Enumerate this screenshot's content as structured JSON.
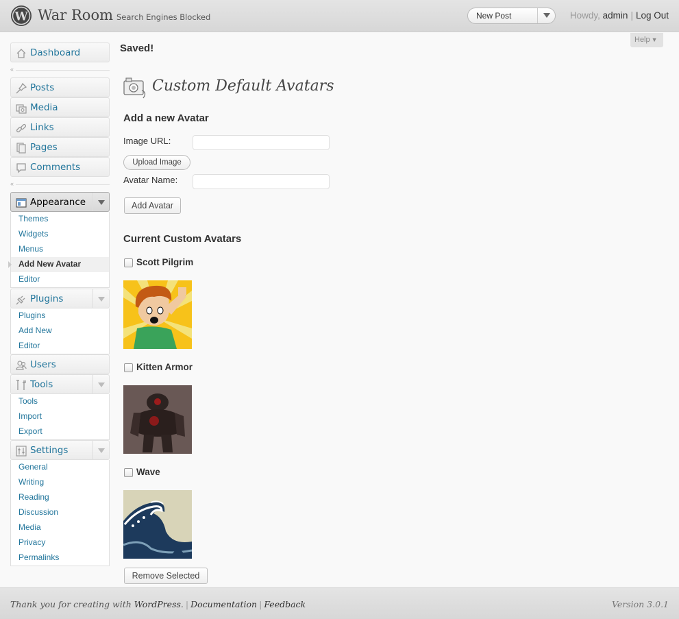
{
  "header": {
    "site_title": "War Room",
    "site_subtitle": "Search Engines Blocked",
    "favorite_action": "New Post",
    "howdy": "Howdy, ",
    "user": "admin",
    "separator": "|",
    "logout": "Log Out"
  },
  "help": {
    "label": "Help",
    "arrow": "▼"
  },
  "sidebar": {
    "collapse_glyph": "«",
    "dashboard": "Dashboard",
    "posts": "Posts",
    "media": "Media",
    "links": "Links",
    "pages": "Pages",
    "comments": "Comments",
    "appearance": {
      "label": "Appearance",
      "items": [
        "Themes",
        "Widgets",
        "Menus",
        "Add New Avatar",
        "Editor"
      ]
    },
    "plugins": {
      "label": "Plugins",
      "items": [
        "Plugins",
        "Add New",
        "Editor"
      ]
    },
    "users": "Users",
    "tools": {
      "label": "Tools",
      "items": [
        "Tools",
        "Import",
        "Export"
      ]
    },
    "settings": {
      "label": "Settings",
      "items": [
        "General",
        "Writing",
        "Reading",
        "Discussion",
        "Media",
        "Privacy",
        "Permalinks"
      ]
    }
  },
  "main": {
    "notice": "Saved!",
    "title": "Custom Default Avatars",
    "add_heading": "Add a new Avatar",
    "image_url_label": "Image URL:",
    "image_url_value": "",
    "upload_button": "Upload Image",
    "avatar_name_label": "Avatar Name:",
    "avatar_name_value": "",
    "add_button": "Add Avatar",
    "current_heading": "Current Custom Avatars",
    "avatars": [
      {
        "name": "Scott Pilgrim",
        "checked": false
      },
      {
        "name": "Kitten Armor",
        "checked": false
      },
      {
        "name": "Wave",
        "checked": false
      }
    ],
    "remove_button": "Remove Selected"
  },
  "footer": {
    "thanks": "Thank you for creating with ",
    "wordpress": "WordPress",
    "period": ".",
    "sep": "|",
    "documentation": "Documentation",
    "feedback": "Feedback",
    "version": "Version 3.0.1"
  },
  "colors": {
    "link": "#21759b",
    "header_bg": "#dfdfdf",
    "page_bg": "#f9f9f9"
  }
}
